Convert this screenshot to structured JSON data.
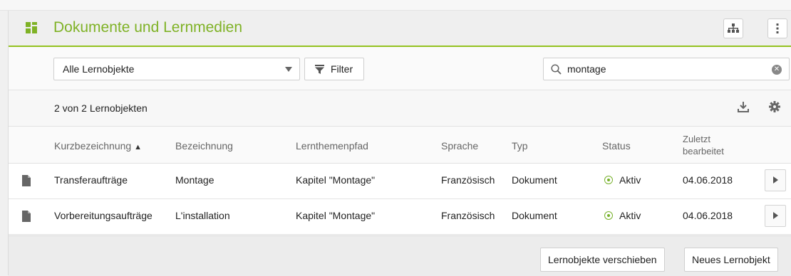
{
  "header": {
    "title": "Dokumente und Lernmedien",
    "accent_color": "#7fb226",
    "buttons": [
      {
        "icon": "hierarchy-icon"
      },
      {
        "icon": "more-vertical-icon"
      }
    ]
  },
  "toolbar": {
    "select_value": "Alle Lernobjekte",
    "filter_label": "Filter",
    "search_value": "montage"
  },
  "count_text": "2 von 2 Lernobjekten",
  "table": {
    "columns": {
      "kurz": "Kurzbezeichnung",
      "kurz_sort": "▲",
      "bez": "Bezeichnung",
      "pfad": "Lernthemenpfad",
      "sprache": "Sprache",
      "typ": "Typ",
      "status": "Status",
      "zuletzt_1": "Zuletzt",
      "zuletzt_2": "bearbeitet"
    },
    "rows": [
      {
        "kurz": "Transferaufträge",
        "bez": "Montage",
        "pfad": "Kapitel \"Montage\"",
        "sprache": "Französisch",
        "typ": "Dokument",
        "status": "Aktiv",
        "date": "04.06.2018"
      },
      {
        "kurz": "Vorbereitungsaufträge",
        "bez": "L'installation",
        "pfad": "Kapitel \"Montage\"",
        "sprache": "Französisch",
        "typ": "Dokument",
        "status": "Aktiv",
        "date": "04.06.2018"
      }
    ]
  },
  "footer": {
    "move_label": "Lernobjekte verschieben",
    "new_label": "Neues Lernobjekt"
  }
}
